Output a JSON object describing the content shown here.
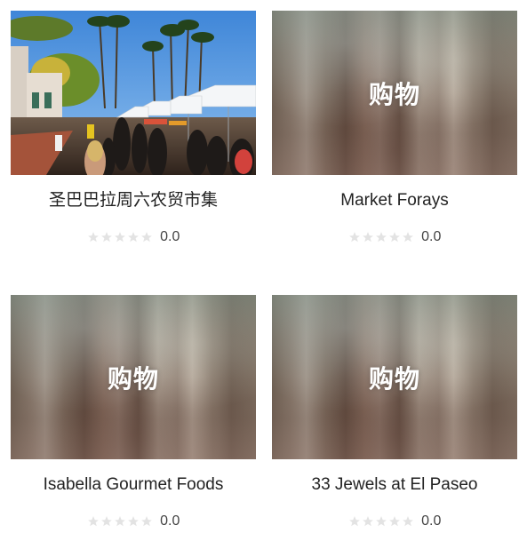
{
  "placeholder_text": "购物",
  "star_color_empty": "#e3e3e3",
  "cards": [
    {
      "title": "圣巴巴拉周六农贸市集",
      "rating": "0.0",
      "image": "farmers-market-photo"
    },
    {
      "title": "Market Forays",
      "rating": "0.0",
      "image": "placeholder"
    },
    {
      "title": "Isabella Gourmet Foods",
      "rating": "0.0",
      "image": "placeholder"
    },
    {
      "title": "33 Jewels at El Paseo",
      "rating": "0.0",
      "image": "placeholder"
    }
  ]
}
